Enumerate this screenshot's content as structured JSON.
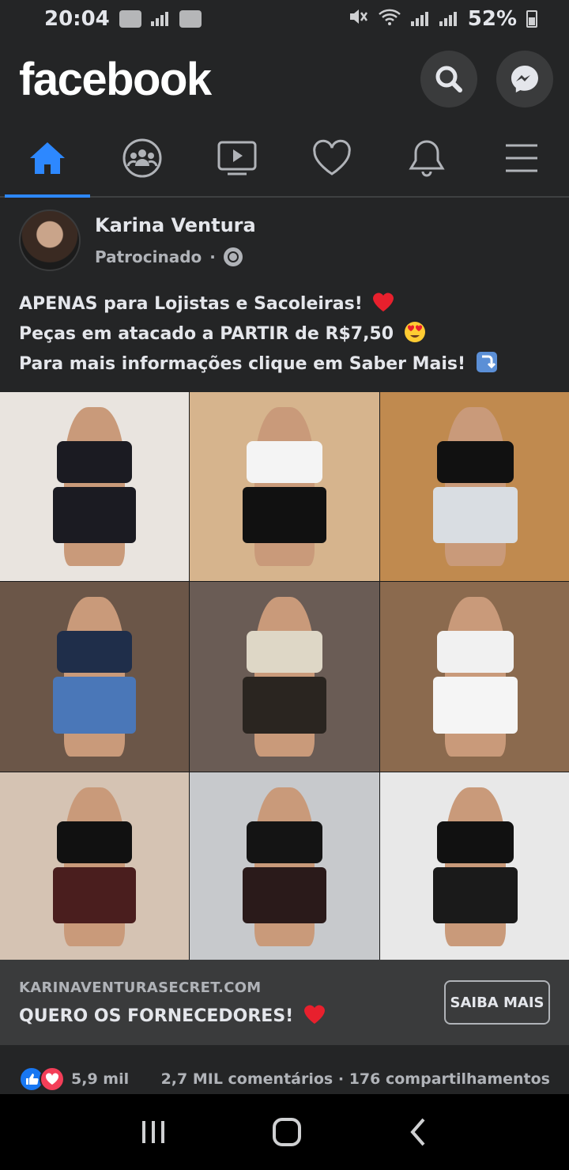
{
  "status": {
    "time": "20:04",
    "battery": "52%"
  },
  "app": {
    "logo": "facebook"
  },
  "post": {
    "author": "Karina Ventura",
    "sponsored": "Patrocinado",
    "separator": "·",
    "lines": [
      "APENAS para Lojistas e Sacoleiras!",
      "Peças em atacado a PARTIR de R$7,50",
      "Para mais informações clique em Saber Mais!"
    ],
    "photos": [
      {
        "top": "#1b1b22",
        "bottom": "#1b1b22",
        "bg": "#e9e4df"
      },
      {
        "top": "#f4f4f4",
        "bottom": "#111111",
        "bg": "#d6b48d"
      },
      {
        "top": "#111111",
        "bottom": "#d9dde2",
        "bg": "#c08a4f"
      },
      {
        "top": "#1f2e4a",
        "bottom": "#4a77b8",
        "bg": "#6b5648"
      },
      {
        "top": "#ded7c6",
        "bottom": "#2a2520",
        "bg": "#6a5c55"
      },
      {
        "top": "#f1f1f1",
        "bottom": "#f5f5f5",
        "bg": "#8b6a4e"
      },
      {
        "top": "#111111",
        "bottom": "#4a1e1e",
        "bg": "#d5c3b3"
      },
      {
        "top": "#141414",
        "bottom": "#2a1a1a",
        "bg": "#c7c9cc"
      },
      {
        "top": "#111111",
        "bottom": "#1a1a1a",
        "bg": "#e8e8e8"
      }
    ]
  },
  "cta": {
    "domain": "KARINAVENTURASECRET.COM",
    "title": "QUERO OS FORNECEDORES!",
    "button": "SAIBA MAIS"
  },
  "stats": {
    "reactions": "5,9 mil",
    "comments": "2,7 MIL comentários",
    "separator": "·",
    "shares": "176 compartilhamentos"
  },
  "colors": {
    "accent": "#2d88ff",
    "like": "#1877f2",
    "love": "#f33e58"
  }
}
